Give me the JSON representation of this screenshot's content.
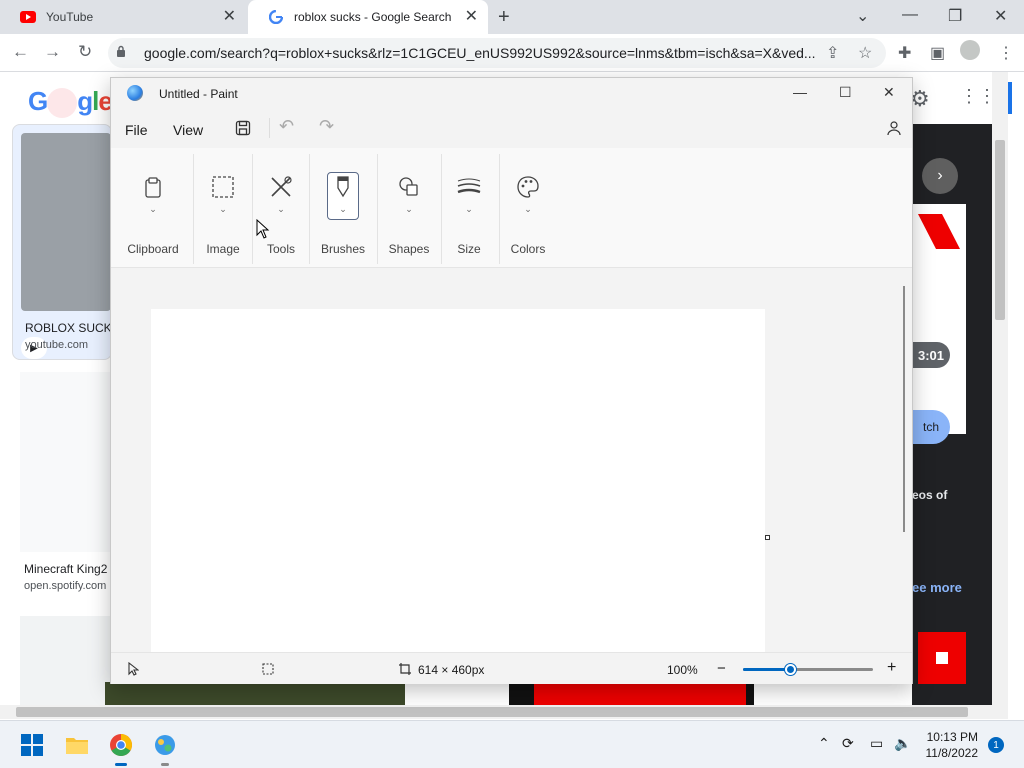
{
  "browser": {
    "tabs": [
      {
        "title": "YouTube",
        "active": false
      },
      {
        "title": "roblox sucks - Google Search",
        "active": true
      }
    ],
    "new_tab": "+",
    "url": "google.com/search?q=roblox+sucks&rlz=1C1GCEU_enUS992US992&source=lnms&tbm=isch&sa=X&ved..."
  },
  "results": [
    {
      "title": "ROBLOX SUCKS",
      "source": "youtube.com"
    },
    {
      "title": "Minecraft King2",
      "source": "open.spotify.com"
    }
  ],
  "right_fragments": {
    "duration": "3:01",
    "watch": "tch",
    "videos_of": "eos of",
    "see_more": "ee more"
  },
  "paint": {
    "title": "Untitled - Paint",
    "menu": {
      "file": "File",
      "view": "View"
    },
    "groups": [
      {
        "label": "Clipboard"
      },
      {
        "label": "Image"
      },
      {
        "label": "Tools"
      },
      {
        "label": "Brushes"
      },
      {
        "label": "Shapes"
      },
      {
        "label": "Size"
      },
      {
        "label": "Colors"
      }
    ],
    "status": {
      "dimensions": "614 × 460px",
      "zoom": "100%",
      "zoom_fraction": 0.37
    }
  },
  "taskbar": {
    "time": "10:13 PM",
    "date": "11/8/2022",
    "notifications": "1"
  },
  "colors": {
    "accent": "#0067c0",
    "google_blue": "#1a73e8",
    "youtube_red": "#ff0000"
  }
}
